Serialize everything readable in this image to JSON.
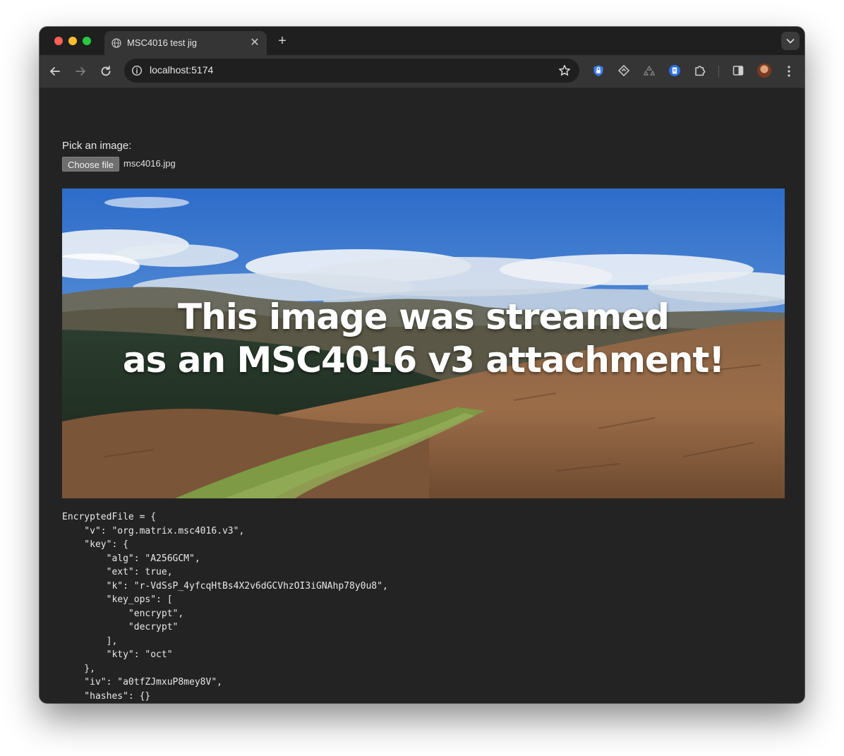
{
  "browser": {
    "tab_title": "MSC4016 test jig",
    "tab_close_glyph": "✕",
    "new_tab_glyph": "+",
    "url": "localhost:5174",
    "icons": [
      "back-icon",
      "forward-icon",
      "reload-icon",
      "info-icon",
      "bookmark-star-icon",
      "shield-extension-icon",
      "diamond-extension-icon",
      "recycle-extension-icon",
      "document-extension-icon",
      "puzzle-extensions-icon",
      "side-panel-icon",
      "profile-avatar",
      "kebab-menu-icon"
    ]
  },
  "page": {
    "pick_label": "Pick an image:",
    "file_button": "Choose file",
    "file_name": "msc4016.jpg",
    "image_caption_line1": "This image was streamed",
    "image_caption_line2": "as an MSC4016 v3 attachment!",
    "json_dump": "EncryptedFile = {\n    \"v\": \"org.matrix.msc4016.v3\",\n    \"key\": {\n        \"alg\": \"A256GCM\",\n        \"ext\": true,\n        \"k\": \"r-VdSsP_4yfcqHtBs4X2v6dGCVhzOI3iGNAhp78y0u8\",\n        \"key_ops\": [\n            \"encrypt\",\n            \"decrypt\"\n        ],\n        \"kty\": \"oct\"\n    },\n    \"iv\": \"a0tfZJmxuP8mey8V\",\n    \"hashes\": {}\n}"
  },
  "colors": {
    "window_bg": "#232323",
    "toolbar_bg": "#353535",
    "text": "#e8e8e8"
  }
}
